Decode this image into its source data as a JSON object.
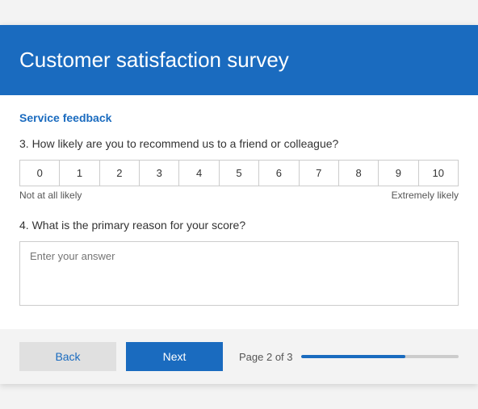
{
  "header": {
    "title": "Customer satisfaction survey"
  },
  "section": {
    "title": "Service feedback"
  },
  "question3": {
    "label": "3. How likely are you to recommend us to a friend or colleague?",
    "scale": [
      0,
      1,
      2,
      3,
      4,
      5,
      6,
      7,
      8,
      9,
      10
    ],
    "label_left": "Not at all likely",
    "label_right": "Extremely likely"
  },
  "question4": {
    "label": "4. What is the primary reason for your score?",
    "placeholder": "Enter your answer"
  },
  "footer": {
    "back_label": "Back",
    "next_label": "Next",
    "page_text": "Page 2 of 3",
    "progress_percent": 66
  }
}
